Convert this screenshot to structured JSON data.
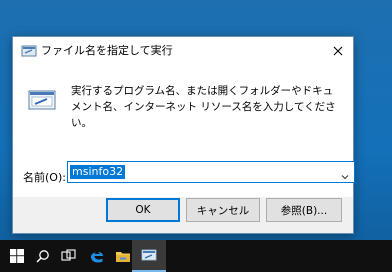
{
  "window": {
    "title": "ファイル名を指定して実行",
    "description": "実行するプログラム名、または開くフォルダーやドキュメント名、インターネット リソース名を入力してください。"
  },
  "form": {
    "name_label": "名前(O):",
    "name_value": "msinfo32"
  },
  "buttons": {
    "ok": "OK",
    "cancel": "キャンセル",
    "browse": "参照(B)..."
  },
  "taskbar": {
    "items": [
      "start-icon",
      "search-icon",
      "task-view-icon",
      "edge-icon",
      "file-explorer-icon",
      "run-app-icon"
    ]
  },
  "colors": {
    "accent": "#0078d7",
    "desktop": "#1470b8",
    "taskbar": "#101010"
  }
}
